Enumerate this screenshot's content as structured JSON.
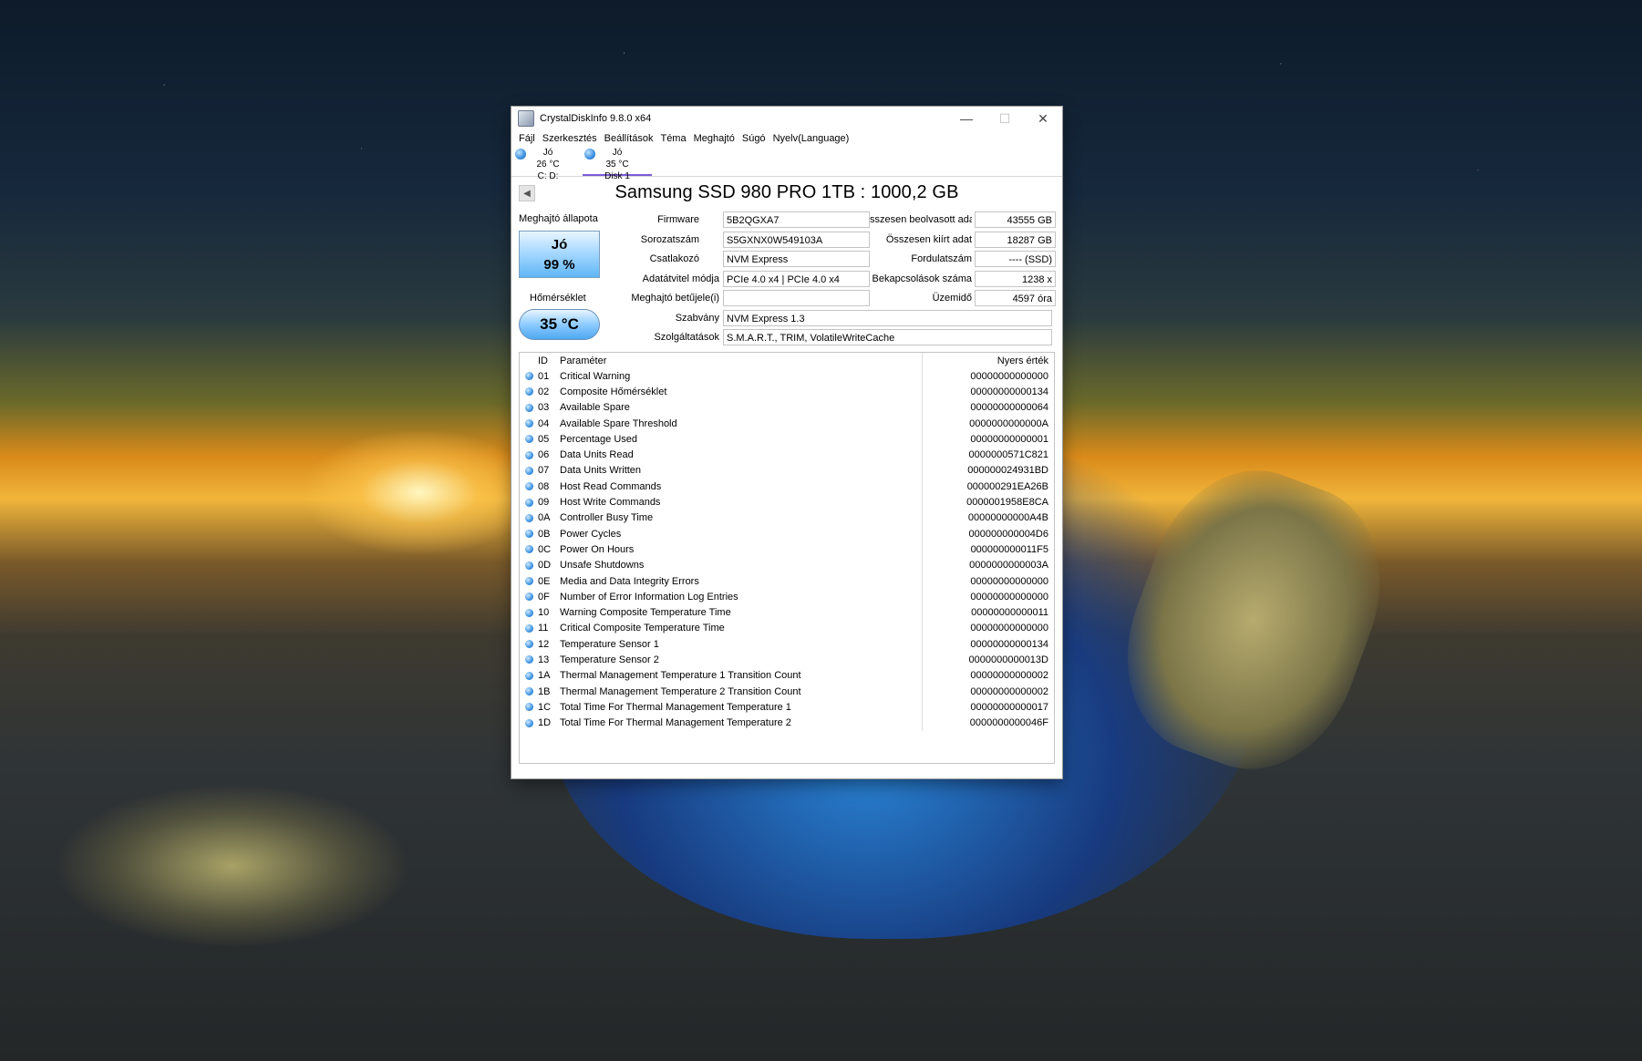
{
  "window": {
    "title": "CrystalDiskInfo 9.8.0 x64",
    "minimize_glyph": "—",
    "maximize_glyph": "☐",
    "close_glyph": "✕"
  },
  "menu": [
    "Fájl",
    "Szerkesztés",
    "Beállítások",
    "Téma",
    "Meghajtó",
    "Súgó",
    "Nyelv(Language)"
  ],
  "disk_tabs": [
    {
      "status": "Jó",
      "temp": "26 °C",
      "name": "C: D:",
      "active": false
    },
    {
      "status": "Jó",
      "temp": "35 °C",
      "name": "Disk 1",
      "active": true
    }
  ],
  "drive": {
    "title": "Samsung SSD 980 PRO 1TB : 1000,2 GB",
    "prev_glyph": "◀",
    "status_label": "Meghajtó állapota",
    "health_status": "Jó",
    "health_percent": "99 %",
    "temp_label": "Hőmérséklet",
    "temperature": "35 °C"
  },
  "info_left": [
    {
      "label": "Firmware",
      "value": "5B2QGXA7"
    },
    {
      "label": "Sorozatszám",
      "value": "S5GXNX0W549103A"
    },
    {
      "label": "Csatlakozó",
      "value": "NVM Express"
    },
    {
      "label": "Adatátvitel módja",
      "value": "PCIe 4.0 x4 | PCIe 4.0 x4"
    },
    {
      "label": "Meghajtó betűjele(i)",
      "value": ""
    },
    {
      "label": "Szabvány",
      "value": "NVM Express 1.3"
    },
    {
      "label": "Szolgáltatások",
      "value": "S.M.A.R.T., TRIM, VolatileWriteCache"
    }
  ],
  "info_right": [
    {
      "label": "sszesen beolvasott adat",
      "value": "43555 GB"
    },
    {
      "label": "Összesen kiírt adat",
      "value": "18287 GB"
    },
    {
      "label": "Fordulatszám",
      "value": "---- (SSD)"
    },
    {
      "label": "Bekapcsolások száma",
      "value": "1238 x"
    },
    {
      "label": "Üzemidő",
      "value": "4597 óra"
    }
  ],
  "smart": {
    "headers": {
      "id": "ID",
      "param": "Paraméter",
      "raw": "Nyers érték"
    },
    "rows": [
      {
        "id": "01",
        "param": "Critical Warning",
        "raw": "00000000000000"
      },
      {
        "id": "02",
        "param": "Composite Hőmérséklet",
        "raw": "00000000000134"
      },
      {
        "id": "03",
        "param": "Available Spare",
        "raw": "00000000000064"
      },
      {
        "id": "04",
        "param": "Available Spare Threshold",
        "raw": "0000000000000A"
      },
      {
        "id": "05",
        "param": "Percentage Used",
        "raw": "00000000000001"
      },
      {
        "id": "06",
        "param": "Data Units Read",
        "raw": "0000000571C821"
      },
      {
        "id": "07",
        "param": "Data Units Written",
        "raw": "000000024931BD"
      },
      {
        "id": "08",
        "param": "Host Read Commands",
        "raw": "000000291EA26B"
      },
      {
        "id": "09",
        "param": "Host Write Commands",
        "raw": "0000001958E8CA"
      },
      {
        "id": "0A",
        "param": "Controller Busy Time",
        "raw": "00000000000A4B"
      },
      {
        "id": "0B",
        "param": "Power Cycles",
        "raw": "000000000004D6"
      },
      {
        "id": "0C",
        "param": "Power On Hours",
        "raw": "000000000011F5"
      },
      {
        "id": "0D",
        "param": "Unsafe Shutdowns",
        "raw": "0000000000003A"
      },
      {
        "id": "0E",
        "param": "Media and Data Integrity Errors",
        "raw": "00000000000000"
      },
      {
        "id": "0F",
        "param": "Number of Error Information Log Entries",
        "raw": "00000000000000"
      },
      {
        "id": "10",
        "param": "Warning Composite Temperature Time",
        "raw": "00000000000011"
      },
      {
        "id": "11",
        "param": "Critical Composite Temperature Time",
        "raw": "00000000000000"
      },
      {
        "id": "12",
        "param": "Temperature Sensor 1",
        "raw": "00000000000134"
      },
      {
        "id": "13",
        "param": "Temperature Sensor 2",
        "raw": "0000000000013D"
      },
      {
        "id": "1A",
        "param": "Thermal Management Temperature 1 Transition Count",
        "raw": "00000000000002"
      },
      {
        "id": "1B",
        "param": "Thermal Management Temperature 2 Transition Count",
        "raw": "00000000000002"
      },
      {
        "id": "1C",
        "param": "Total Time For Thermal Management Temperature 1",
        "raw": "00000000000017"
      },
      {
        "id": "1D",
        "param": "Total Time For Thermal Management Temperature 2",
        "raw": "0000000000046F"
      }
    ]
  }
}
